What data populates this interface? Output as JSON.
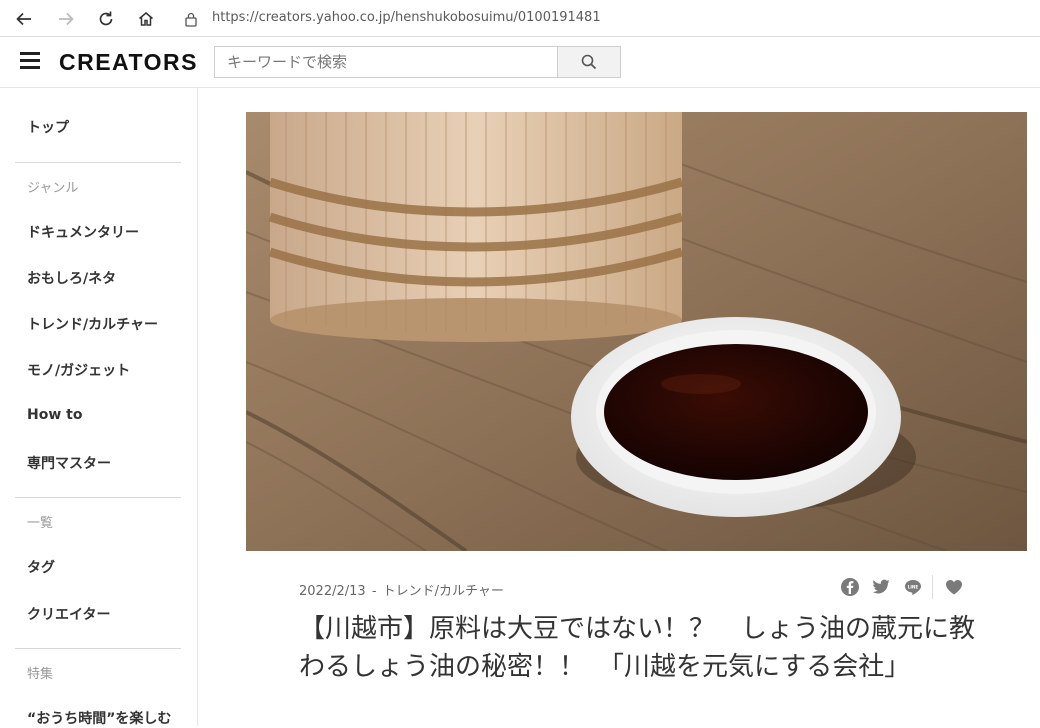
{
  "browser": {
    "url": "https://creators.yahoo.co.jp/henshukobosuimu/0100191481"
  },
  "header": {
    "logo": "CREATORS",
    "search_placeholder": "キーワードで検索"
  },
  "sidebar": {
    "top": "トップ",
    "genre_heading": "ジャンル",
    "genres": [
      "ドキュメンタリー",
      "おもしろ/ネタ",
      "トレンド/カルチャー",
      "モノ/ガジェット",
      "How to",
      "専門マスター"
    ],
    "list_heading": "一覧",
    "lists": [
      "タグ",
      "クリエイター"
    ],
    "feature_heading": "特集",
    "features": [
      "“おうち時間”を楽しむ"
    ]
  },
  "article": {
    "date": "2022/2/13",
    "separator": "-",
    "category": "トレンド/カルチャー",
    "title": "【川越市】原料は大豆ではない！？　しょう油の蔵元に教わるしょう油の秘密！！　「川越を元気にする会社」",
    "share_icons": [
      "facebook-icon",
      "twitter-icon",
      "line-icon",
      "heart-icon"
    ]
  },
  "colors": {
    "icon_gray": "#7a7a7a",
    "text": "#333333",
    "muted": "#999999"
  }
}
